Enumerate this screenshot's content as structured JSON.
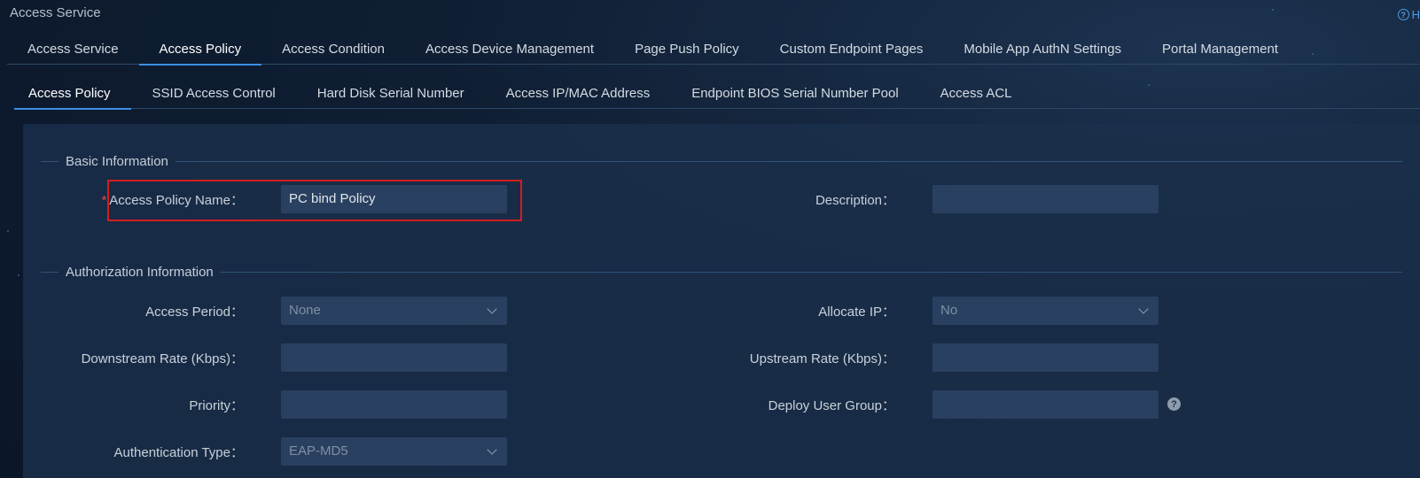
{
  "app": {
    "title": "Access Service",
    "help_label": "H"
  },
  "main_tabs": [
    {
      "label": "Access Service",
      "active": false
    },
    {
      "label": "Access Policy",
      "active": true
    },
    {
      "label": "Access Condition",
      "active": false
    },
    {
      "label": "Access Device Management",
      "active": false
    },
    {
      "label": "Page Push Policy",
      "active": false
    },
    {
      "label": "Custom Endpoint Pages",
      "active": false
    },
    {
      "label": "Mobile App AuthN Settings",
      "active": false
    },
    {
      "label": "Portal Management",
      "active": false
    }
  ],
  "sub_tabs": [
    {
      "label": "Access Policy",
      "active": true
    },
    {
      "label": "SSID Access Control",
      "active": false
    },
    {
      "label": "Hard Disk Serial Number",
      "active": false
    },
    {
      "label": "Access IP/MAC Address",
      "active": false
    },
    {
      "label": "Endpoint BIOS Serial Number Pool",
      "active": false
    },
    {
      "label": "Access ACL",
      "active": false
    }
  ],
  "basic": {
    "title": "Basic Information",
    "policy_name_label": "Access Policy Name：",
    "policy_name_value": "PC bind Policy",
    "required_mark": "*",
    "description_label": "Description：",
    "description_value": ""
  },
  "auth": {
    "title": "Authorization Information",
    "access_period_label": "Access Period：",
    "access_period_value": "None",
    "allocate_ip_label": "Allocate IP：",
    "allocate_ip_value": "No",
    "downstream_label": "Downstream Rate (Kbps)：",
    "downstream_value": "",
    "upstream_label": "Upstream Rate (Kbps)：",
    "upstream_value": "",
    "priority_label": "Priority：",
    "priority_value": "",
    "deploy_group_label": "Deploy User Group：",
    "deploy_group_value": "",
    "auth_type_label": "Authentication Type：",
    "auth_type_value": "EAP-MD5"
  },
  "icons": {
    "help": "help-circle-icon",
    "info": "question-icon",
    "dropdown": "chevron-down-icon"
  },
  "colors": {
    "accent": "#3d8ee6",
    "highlight": "#d21e1e",
    "required": "#e04848"
  }
}
